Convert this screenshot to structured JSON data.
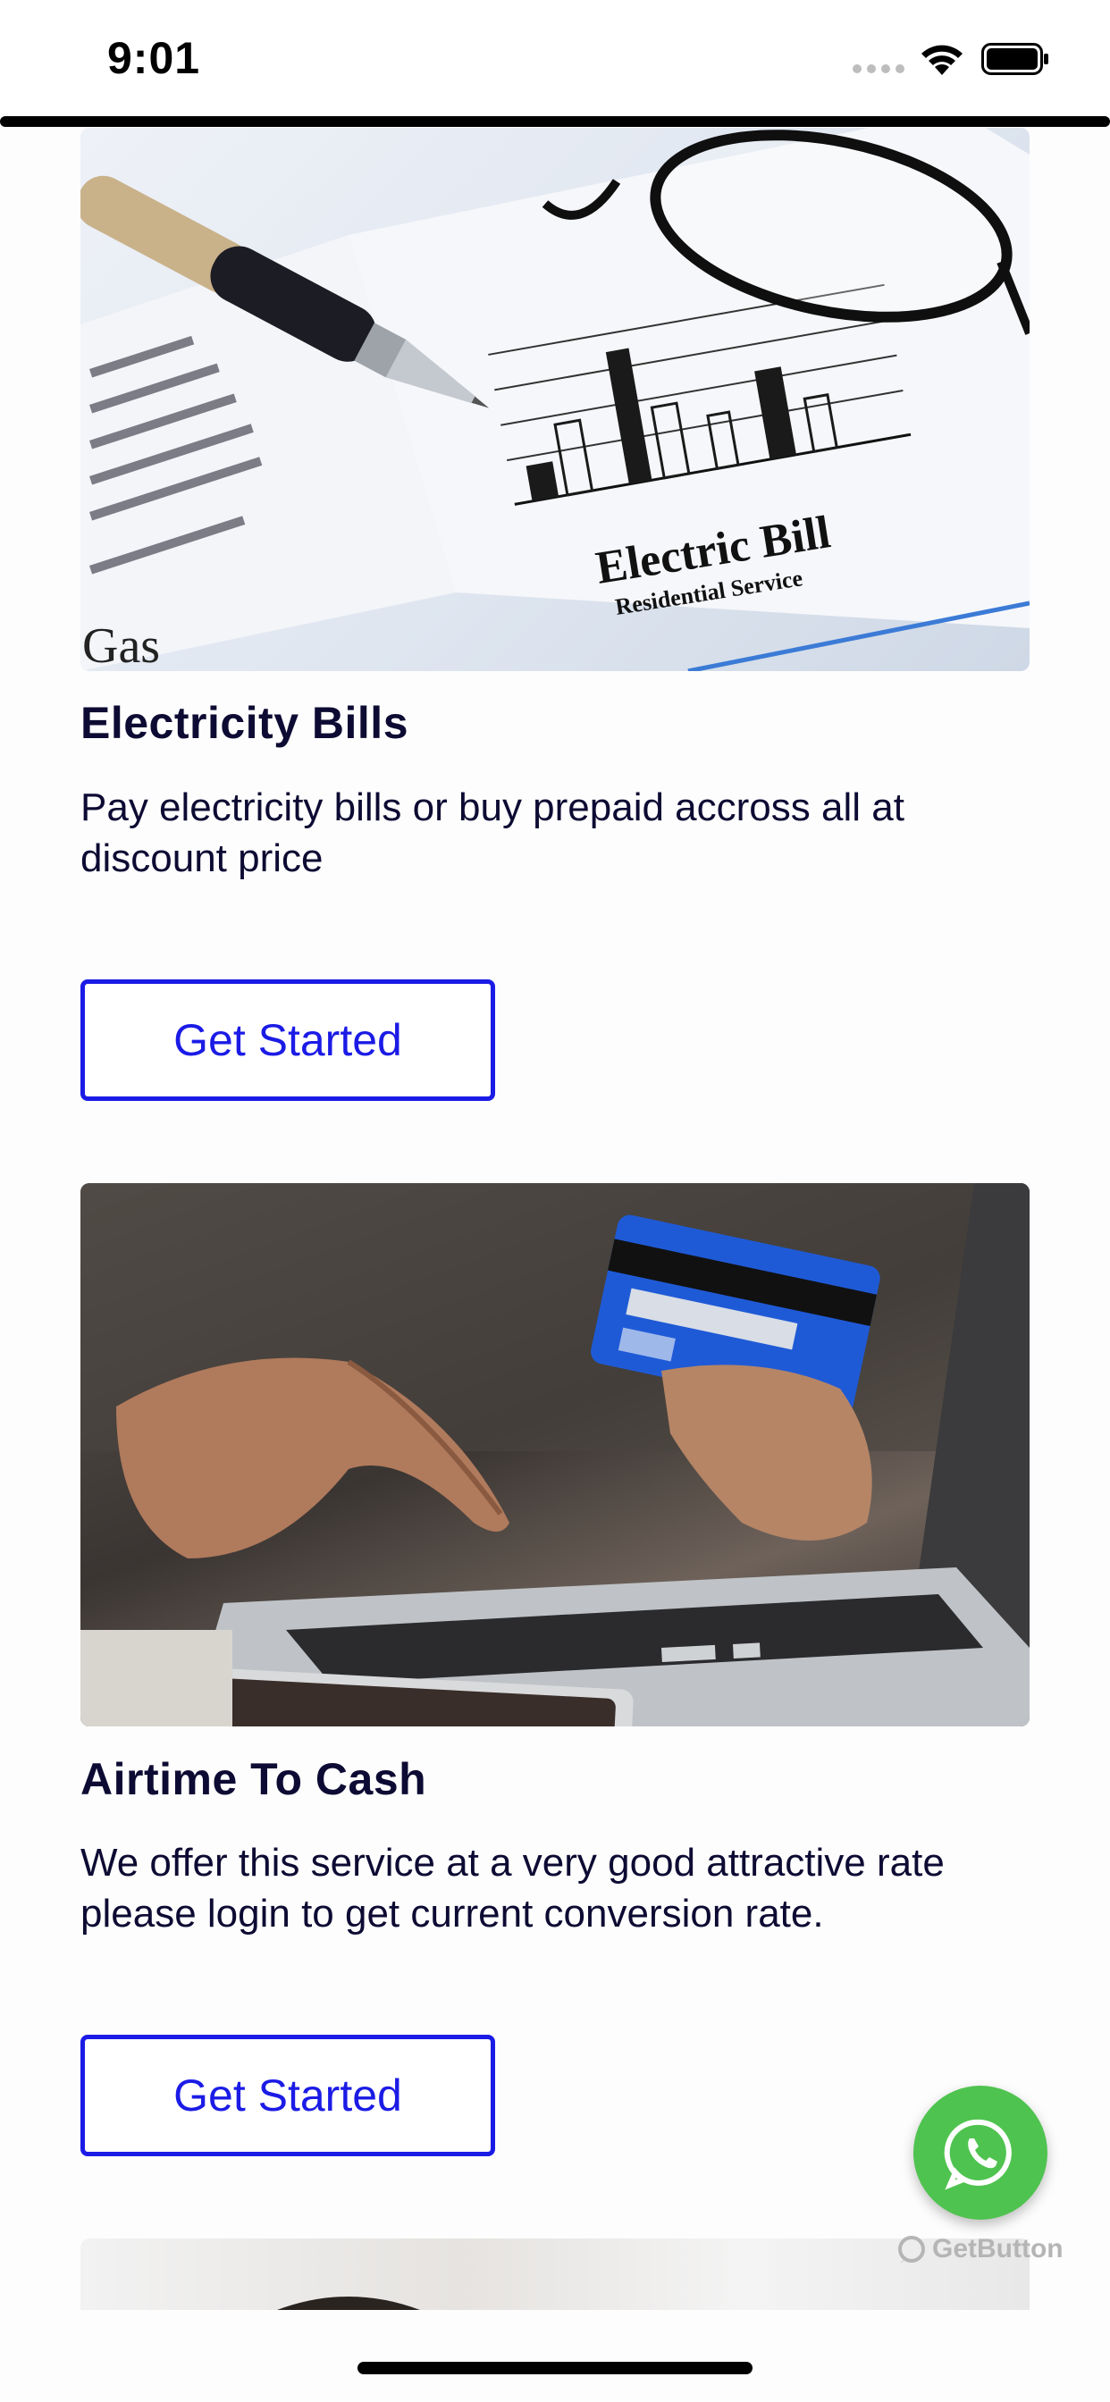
{
  "status_bar": {
    "time": "9:01"
  },
  "cards": [
    {
      "title": "Electricity Bills",
      "description": "Pay electricity bills or buy prepaid accross all at discount price",
      "button_label": "Get Started",
      "image_text": {
        "heading": "Electric Bill",
        "subheading": "Residential Service",
        "brand": "Gas"
      }
    },
    {
      "title": "Airtime To Cash",
      "description": "We offer this service at a very good attractive rate please login to get current conversion rate.",
      "button_label": "Get Started"
    }
  ],
  "whatsapp": {
    "icon": "whatsapp-icon",
    "brand_label": "GetButton"
  },
  "colors": {
    "accent": "#1b1be6",
    "text": "#0d0b33",
    "whatsapp": "#4fc34f"
  }
}
